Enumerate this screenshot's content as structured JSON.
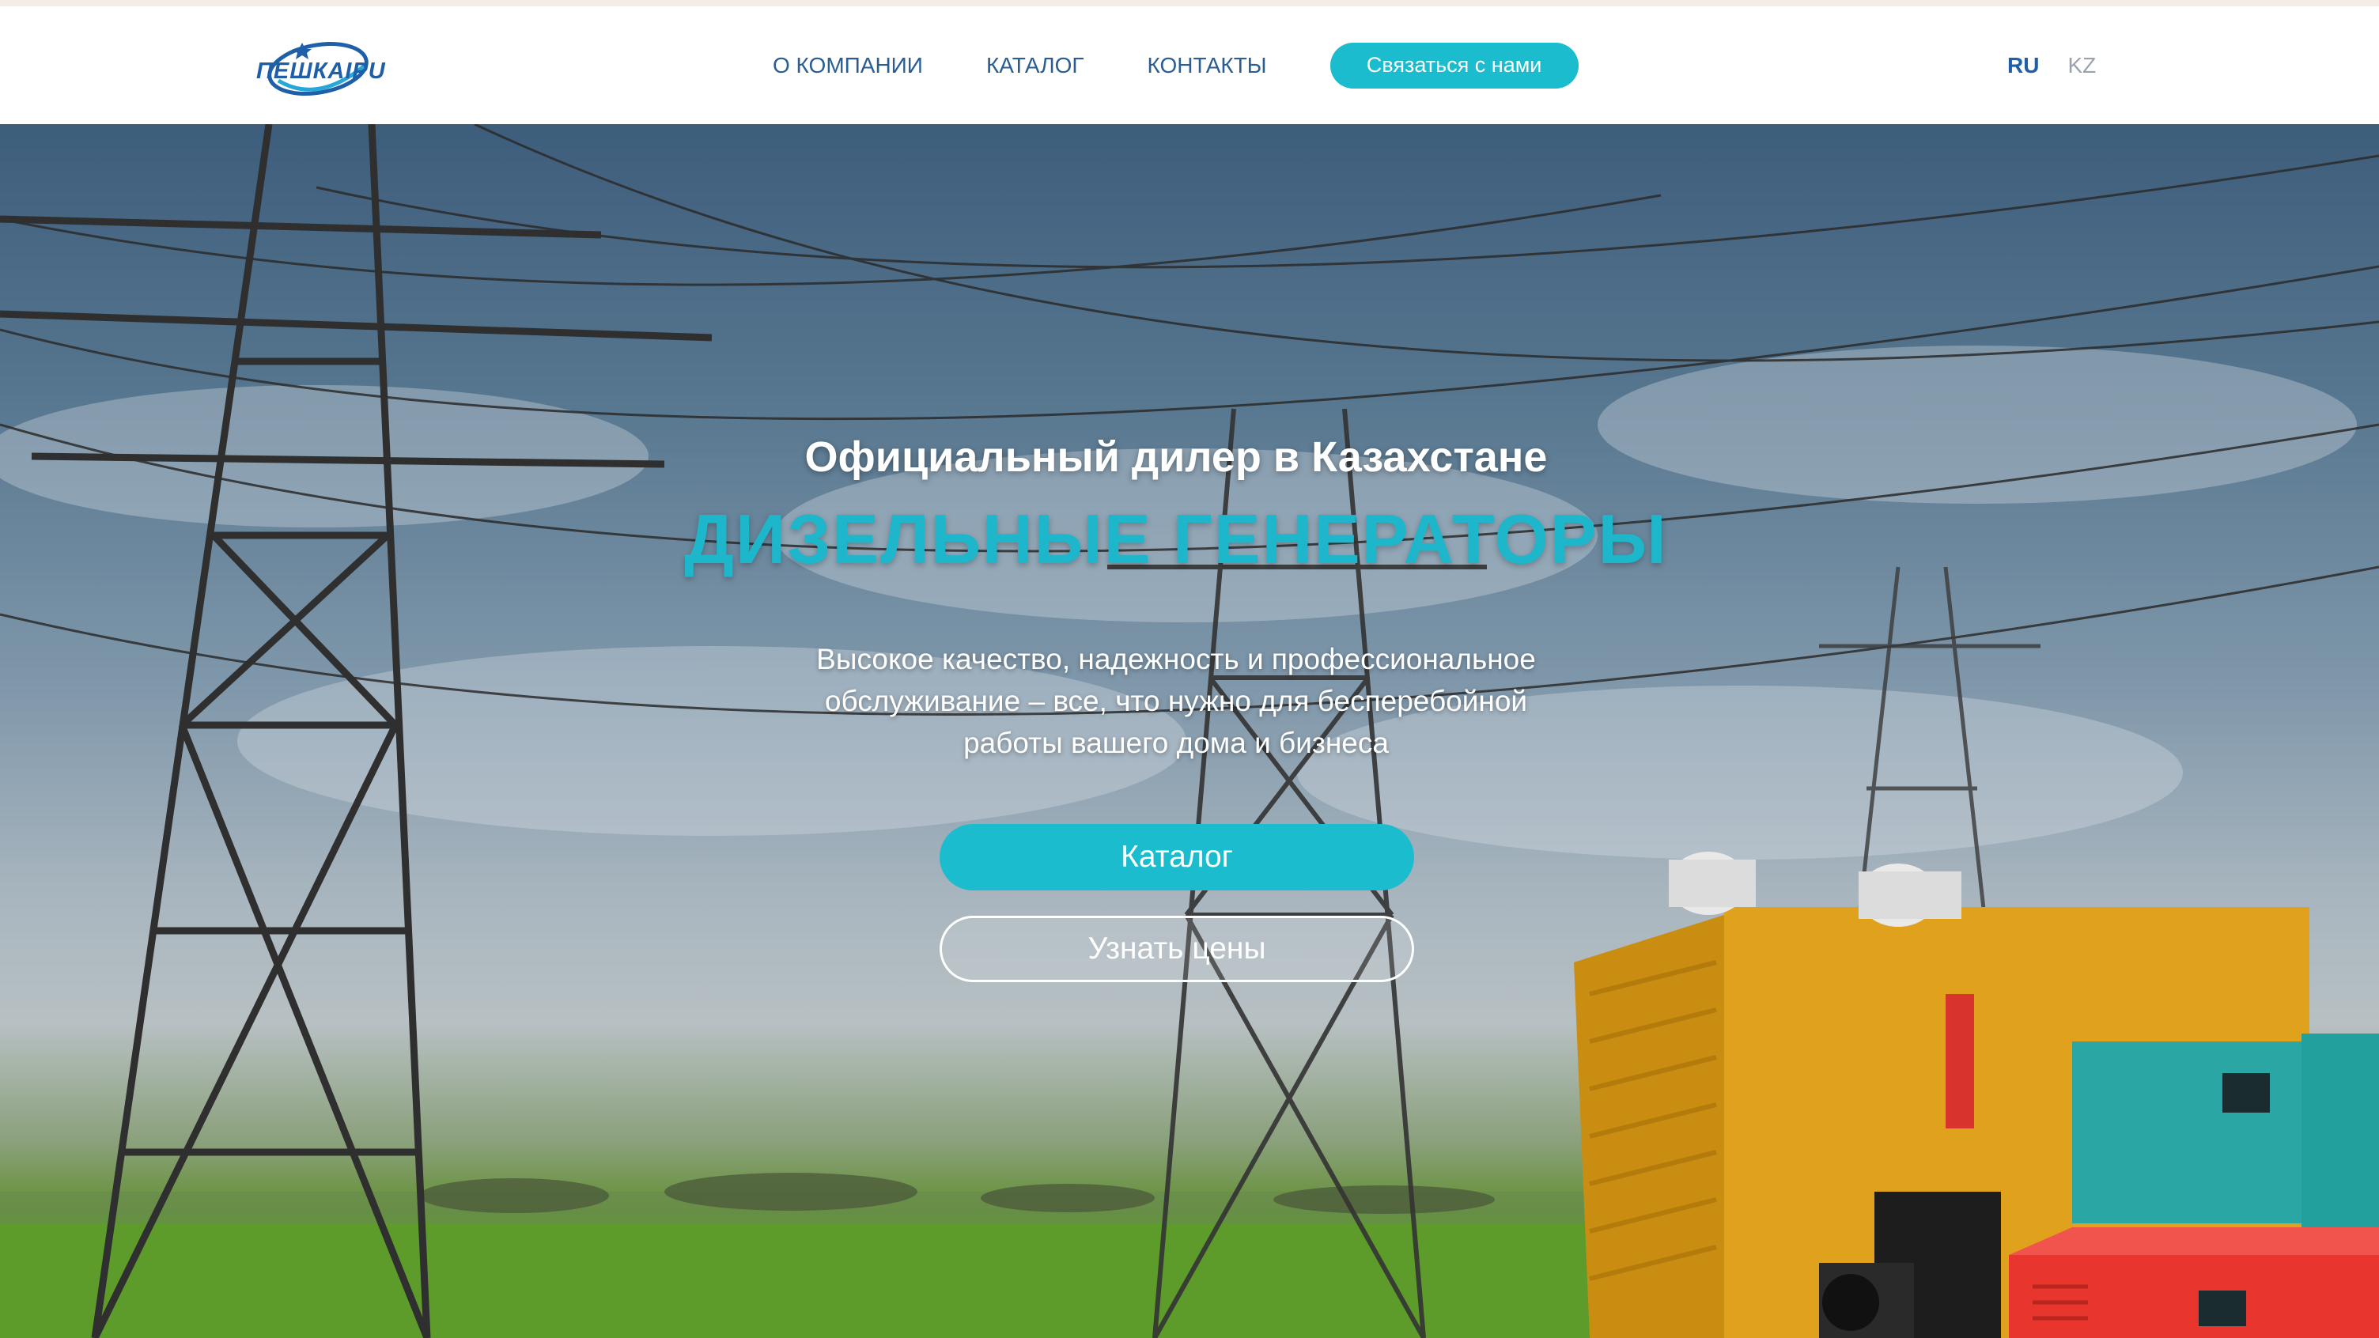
{
  "header": {
    "logo_text": "ПЕШКАІРU",
    "nav": [
      {
        "label": "О КОМПАНИИ"
      },
      {
        "label": "КАТАЛОГ"
      },
      {
        "label": "КОНТАКТЫ"
      }
    ],
    "contact_button": "Связаться с нами",
    "languages": [
      {
        "label": "RU",
        "active": true
      },
      {
        "label": "KZ",
        "active": false
      }
    ]
  },
  "hero": {
    "subtitle": "Официальный дилер в Казахстане",
    "title": "ДИЗЕЛЬНЫЕ ГЕНЕРАТОРЫ",
    "description": "Высокое качество, надежность и профессиональное обслуживание – все, что нужно для бесперебойной работы вашего дома и бизнеса",
    "primary_button": "Каталог",
    "secondary_button": "Узнать цены"
  },
  "colors": {
    "accent": "#1bbccd",
    "nav_text": "#2a5e93",
    "generator_yellow": "#e0a21c",
    "generator_red": "#e8362e",
    "generator_teal": "#2aa7a5"
  }
}
